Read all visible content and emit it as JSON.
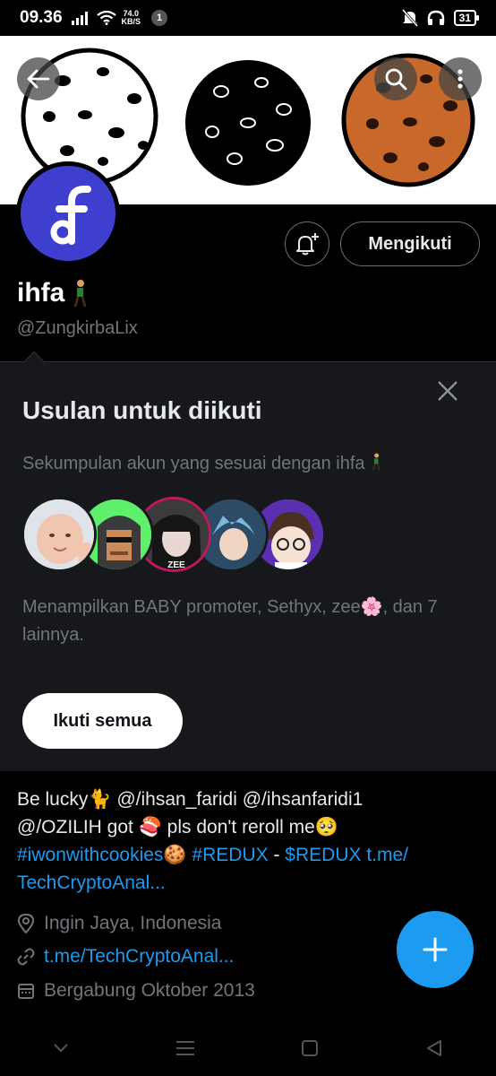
{
  "status_bar": {
    "time": "09.36",
    "net_speed_value": "74.0",
    "net_speed_unit": "KB/S",
    "notification_count": "1",
    "battery": "31"
  },
  "profile": {
    "display_name": "ihfa",
    "handle": "@ZungkirbaLix",
    "follow_button_label": "Mengikuti",
    "avatar_color": "#3f3fcf"
  },
  "suggestions": {
    "title": "Usulan untuk diikuti",
    "subtitle": "Sekumpulan akun yang sesuai dengan ihfa",
    "shown_names": "Menampilkan BABY promoter, Sethyx, zee🌸, dan 7 lainnya.",
    "follow_all_label": "Ikuti semua",
    "zee_tag": "ZEE"
  },
  "bio": {
    "line1_text": "Be lucky🐈 @/ihsan_faridi @/ihsanfaridi1",
    "line2_text": "@/OZILIH got 🍣 pls don't reroll me🥺",
    "hashtag1": "#iwonwithcookies🍪",
    "hashtag2": "#REDUX",
    "dash": " - ",
    "cashtag": "$REDUX",
    "link_start": "t.me/",
    "link_end": "TechCryptoAnal..."
  },
  "meta": {
    "location": "Ingin Jaya, Indonesia",
    "website": "t.me/TechCryptoAnal...",
    "joined": "Bergabung Oktober 2013"
  },
  "colors": {
    "accent": "#1d9bf0",
    "background": "#000000",
    "card": "#16181c",
    "muted": "#71767b"
  }
}
